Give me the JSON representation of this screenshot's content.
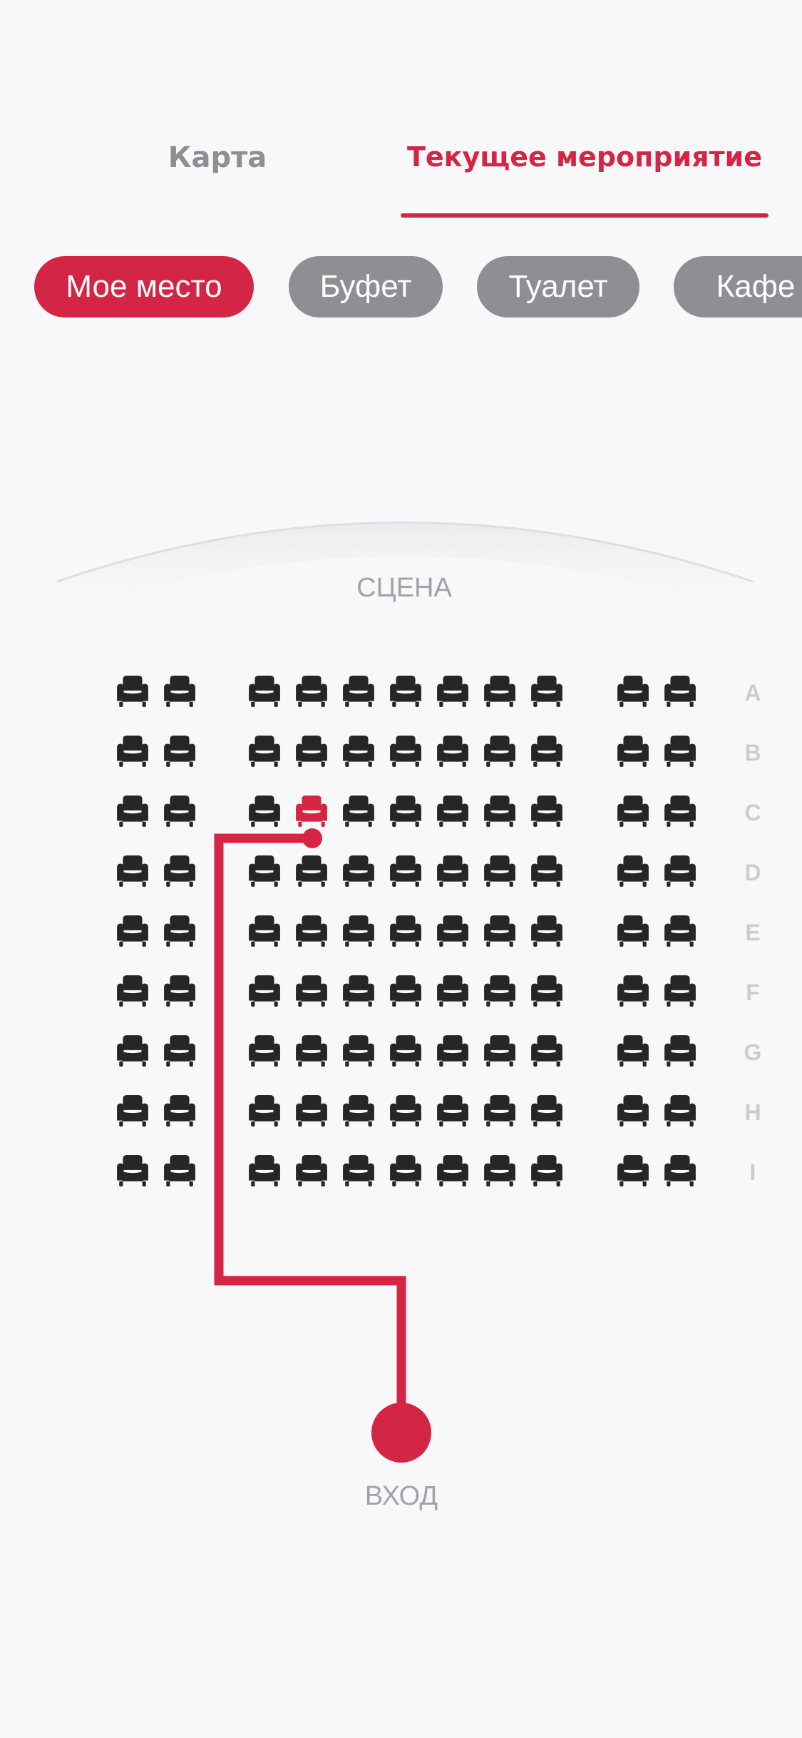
{
  "tabs": [
    {
      "label": "Карта",
      "active": false
    },
    {
      "label": "Текущее мероприятие",
      "active": true
    }
  ],
  "chips": [
    {
      "label": "Мое место",
      "active": true
    },
    {
      "label": "Буфет",
      "active": false
    },
    {
      "label": "Туалет",
      "active": false
    },
    {
      "label": "Кафе",
      "active": false
    }
  ],
  "hall": {
    "stage_label": "СЦЕНА",
    "entrance_label": "ВХОД",
    "rows": [
      "A",
      "B",
      "C",
      "D",
      "E",
      "F",
      "G",
      "H",
      "I"
    ],
    "seats_per_row": 11,
    "seat_blocks": [
      2,
      7,
      2
    ],
    "my_seat": {
      "row": "C",
      "seat": 4
    },
    "icons": {
      "seat": "armchair-icon",
      "my_seat": "armchair-icon"
    }
  },
  "colors": {
    "accent": "#d42644",
    "chip_inactive": "#8e8e93",
    "seat": "#262626",
    "background": "#f8f8fa",
    "row_letter": "#cdcdd1",
    "muted_text": "#a2a2a8"
  }
}
